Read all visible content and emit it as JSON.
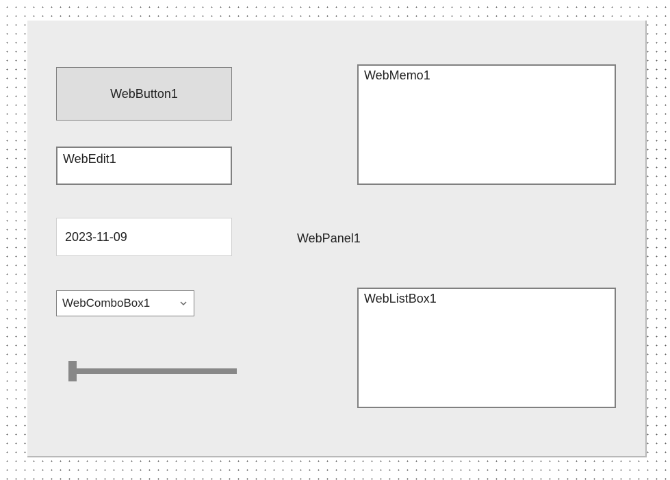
{
  "button": {
    "label": "WebButton1"
  },
  "edit": {
    "value": "WebEdit1"
  },
  "date": {
    "value": "2023-11-09"
  },
  "combo": {
    "value": "WebComboBox1"
  },
  "panel": {
    "label": "WebPanel1"
  },
  "memo": {
    "value": "WebMemo1"
  },
  "listbox": {
    "value": "WebListBox1"
  },
  "trackbar": {
    "position": 0
  }
}
